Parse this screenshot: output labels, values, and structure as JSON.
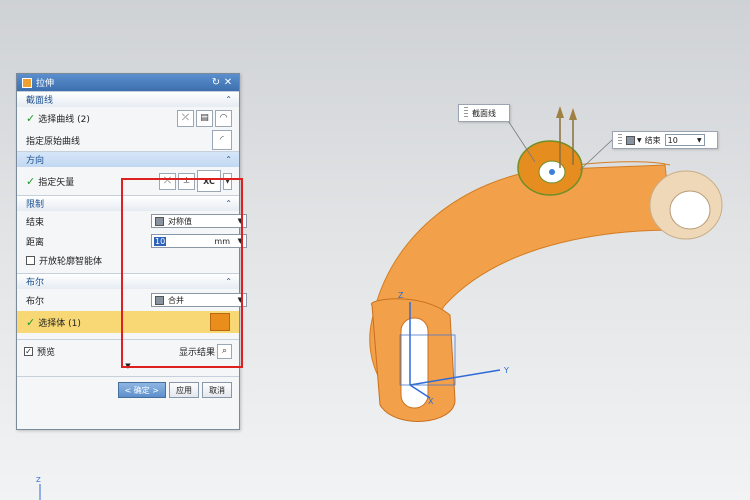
{
  "dialog": {
    "title": "拉伸",
    "groups": {
      "section": {
        "header": "截面线",
        "select_curve_label": "选择曲线 (2)",
        "specify_origin_curve_label": "指定原始曲线"
      },
      "direction": {
        "header": "方向",
        "specify_vector_label": "指定矢量",
        "vector_option": "XC"
      },
      "limits": {
        "header": "限制",
        "end_label": "结束",
        "end_value": "对称值",
        "distance_label": "距离",
        "distance_value": "10",
        "distance_unit": "mm",
        "open_profile_label": "开放轮廓智能体"
      },
      "boolean": {
        "header": "布尔",
        "boolean_label": "布尔",
        "boolean_value": "合并",
        "select_body_label": "选择体 (1)"
      }
    },
    "preview_label": "预览",
    "show_result_label": "显示结果",
    "ok_label": "< 确定 >",
    "apply_label": "应用",
    "cancel_label": "取消"
  },
  "viewport": {
    "section_callout": "截面线",
    "end_callout_label": "结束",
    "end_callout_value": "10",
    "axis_y": "Y",
    "axis_z": "Z",
    "axis_x": "X",
    "mini_axis_z": "Z"
  },
  "colors": {
    "part_orange": "#f2a04a",
    "part_tan": "#eed8b8",
    "highlight_box": "#e02020",
    "title_blue": "#4a7cbb"
  }
}
